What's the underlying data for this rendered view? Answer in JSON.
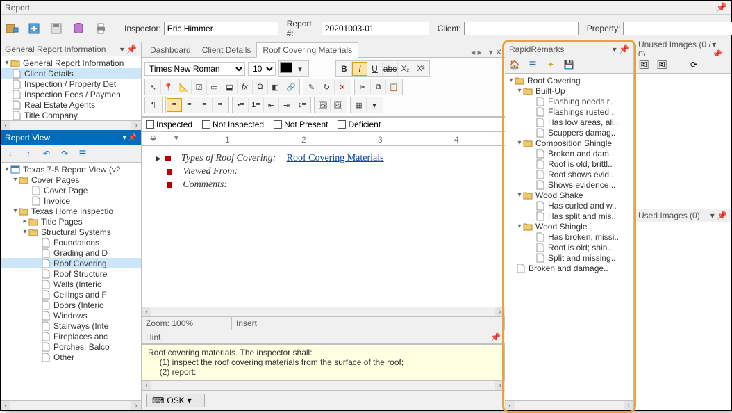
{
  "window": {
    "title": "Report"
  },
  "main_toolbar": {
    "inspector_label": "Inspector:",
    "inspector_value": "Eric Himmer",
    "report_num_label": "Report #:",
    "report_num_value": "20201003-01",
    "client_label": "Client:",
    "client_value": "",
    "property_label": "Property:",
    "property_value": ""
  },
  "left_top": {
    "title": "General Report Information",
    "root": "General Report Information",
    "items": [
      "Client Details",
      "Inspection / Property Det",
      "Inspection Fees / Paymen",
      "Real Estate Agents",
      "Title Company"
    ]
  },
  "report_view": {
    "title": "Report View",
    "root": "Texas 7-5 Report View (v2",
    "cover_pages": "Cover Pages",
    "cover_page": "Cover Page",
    "invoice": "Invoice",
    "txhome": "Texas Home Inspectio",
    "title_pages": "Title Pages",
    "structural": "Structural Systems",
    "items": [
      "Foundations",
      "Grading and D",
      "Roof Covering",
      "Roof Structure",
      "Walls (Interio",
      "Ceilings and F",
      "Doors (Interio",
      "Windows",
      "Stairways (Inte",
      "Fireplaces anc",
      "Porches, Balco",
      "Other"
    ]
  },
  "center": {
    "tabs": [
      "Dashboard",
      "Client Details",
      "Roof Covering Materials"
    ],
    "font_name": "Times New Roman",
    "font_size": "10",
    "checks": [
      "Inspected",
      "Not Inspected",
      "Not Present",
      "Deficient"
    ],
    "doc": {
      "label1": "Types of Roof Covering:",
      "link1": "Roof Covering Materials",
      "label2": "Viewed From:",
      "label3": "Comments:"
    },
    "zoom_label": "Zoom:",
    "zoom_value": "100%",
    "insert_label": "Insert",
    "hint_title": "Hint",
    "hint_lines": [
      "Roof covering materials. The inspector shall:",
      "     (1) inspect the roof covering materials from the surface of the roof;",
      "     (2) report:"
    ],
    "osk": "OSK"
  },
  "remarks": {
    "title": "RapidRemarks",
    "root": "Roof Covering",
    "builtup": "Built-Up",
    "builtup_items": [
      "Flashing needs r..",
      "Flashings rusted ..",
      "Has low areas, all..",
      "Scuppers damag.."
    ],
    "comp": "Composition Shingle",
    "comp_items": [
      "Broken and dam..",
      "Roof is old, brittl..",
      "Roof shows evid..",
      "Shows evidence .."
    ],
    "shake": "Wood Shake",
    "shake_items": [
      "Has curled and w..",
      "Has split and mis.."
    ],
    "shingle": "Wood Shingle",
    "shingle_items": [
      "Has broken, missi..",
      "Roof is old; shin..",
      "Split and missing.."
    ],
    "last": "Broken and damage.."
  },
  "images": {
    "unused_title": "Unused Images (0 / 0)",
    "used_title": "Used Images (0)"
  },
  "ruler_marks": [
    "1",
    "2",
    "3",
    "4"
  ]
}
